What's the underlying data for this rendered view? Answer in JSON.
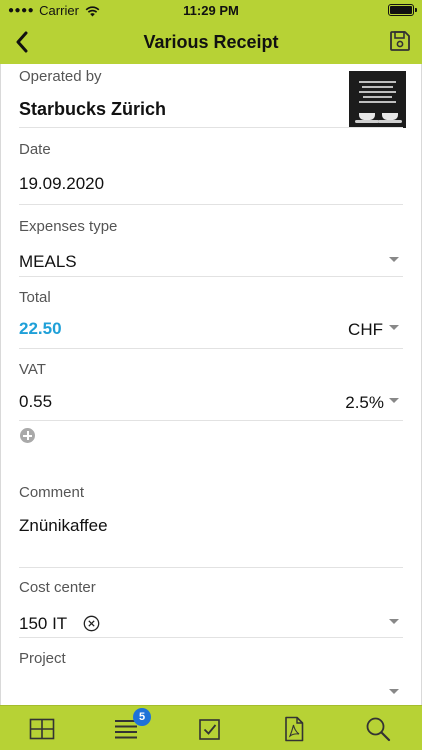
{
  "status_bar": {
    "carrier": "Carrier",
    "time": "11:29 PM"
  },
  "navbar": {
    "title": "Various Receipt",
    "back_icon": "chevron-left-icon",
    "save_icon": "floppy-disk-icon"
  },
  "form": {
    "operated_by": {
      "label": "Operated by",
      "value": "Starbucks Zürich"
    },
    "date": {
      "label": "Date",
      "value": "19.09.2020"
    },
    "expenses_type": {
      "label": "Expenses type",
      "value": "MEALS"
    },
    "total": {
      "label": "Total",
      "value": "22.50",
      "currency": "CHF"
    },
    "vat": {
      "label": "VAT",
      "value": "0.55",
      "rate": "2.5%"
    },
    "comment": {
      "label": "Comment",
      "value": "Znünikaffee"
    },
    "cost_center": {
      "label": "Cost center",
      "value": "150 IT"
    },
    "project": {
      "label": "Project",
      "value": ""
    }
  },
  "tab_bar": {
    "tabs": [
      {
        "icon": "grid-icon"
      },
      {
        "icon": "list-icon",
        "badge": "5"
      },
      {
        "icon": "checkbox-icon"
      },
      {
        "icon": "pdf-icon"
      },
      {
        "icon": "search-icon"
      }
    ]
  },
  "colors": {
    "brand_green": "#b7d235",
    "total_blue": "#1fa0d8",
    "badge_blue": "#1e72d8"
  }
}
